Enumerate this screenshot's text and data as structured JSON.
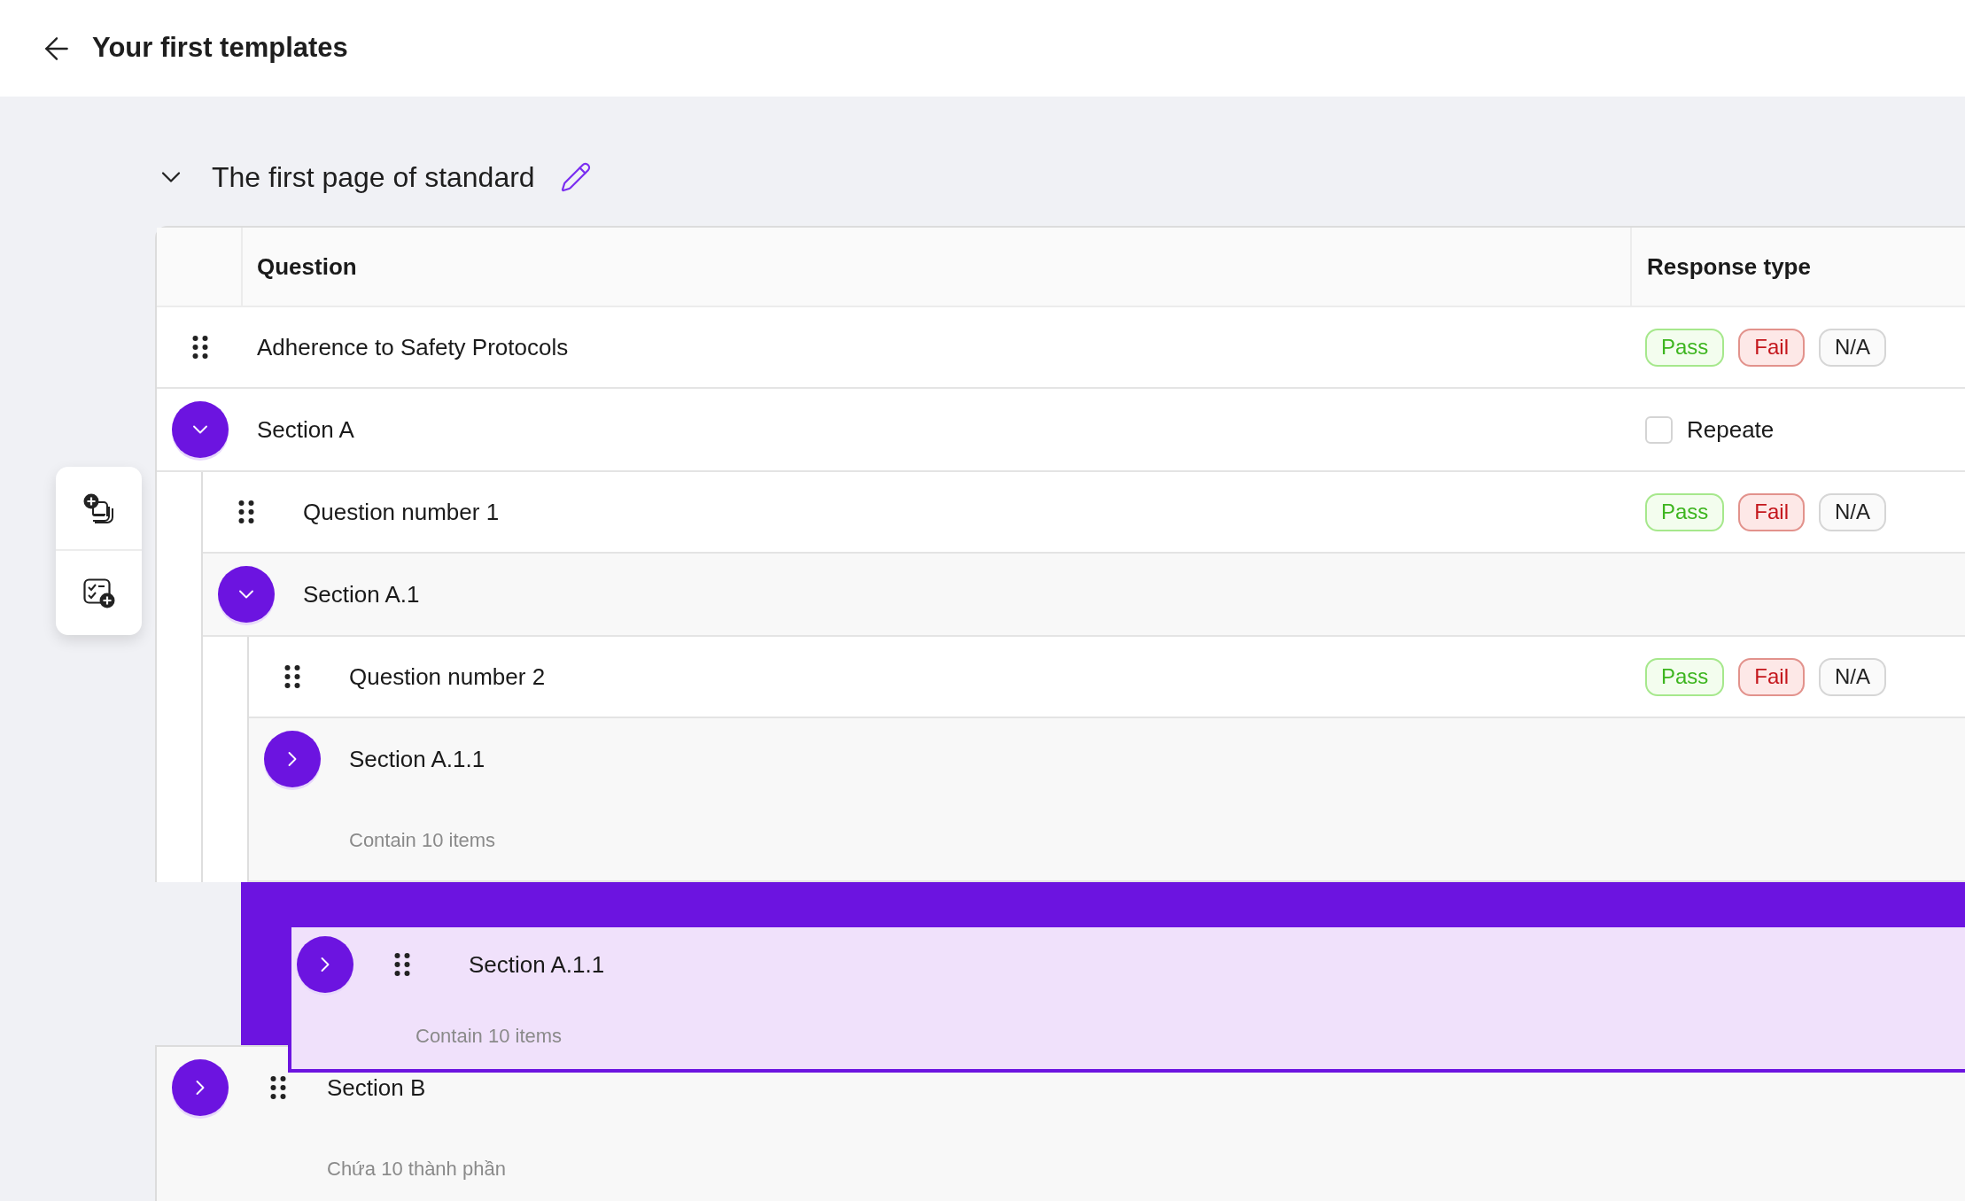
{
  "header": {
    "title": "Your first templates"
  },
  "page": {
    "title": "The first page of standard",
    "expanded": true
  },
  "table": {
    "columns": [
      "Question",
      "Response type"
    ],
    "rows": [
      {
        "kind": "question",
        "label": "Adherence to Safety Protocols",
        "responses": [
          {
            "kind": "pass",
            "label": "Pass"
          },
          {
            "kind": "fail",
            "label": "Fail"
          },
          {
            "kind": "na",
            "label": "N/A"
          }
        ]
      },
      {
        "kind": "section",
        "label": "Section A",
        "expanded": true,
        "handle": false,
        "repeat": {
          "label": "Repeate",
          "checked": false
        },
        "children": [
          {
            "kind": "question",
            "label": "Question number 1",
            "responses": [
              {
                "kind": "pass",
                "label": "Pass"
              },
              {
                "kind": "fail",
                "label": "Fail"
              },
              {
                "kind": "na",
                "label": "N/A"
              }
            ]
          },
          {
            "kind": "section",
            "label": "Section A.1",
            "expanded": true,
            "handle": false,
            "children": [
              {
                "kind": "question",
                "label": "Question number 2",
                "responses": [
                  {
                    "kind": "pass",
                    "label": "Pass"
                  },
                  {
                    "kind": "fail",
                    "label": "Fail"
                  },
                  {
                    "kind": "na",
                    "label": "N/A"
                  }
                ]
              },
              {
                "kind": "section",
                "label": "Section A.1.1",
                "expanded": false,
                "handle": false,
                "summary": "Contain 10 items"
              }
            ]
          }
        ]
      },
      {
        "kind": "section",
        "label": "Section B",
        "expanded": false,
        "handle": true,
        "summary": "Chứa 10 thành phần"
      }
    ]
  },
  "drag_preview": {
    "label": "Section A.1.1",
    "expanded": false,
    "handle": true,
    "summary": "Contain 10 items"
  }
}
